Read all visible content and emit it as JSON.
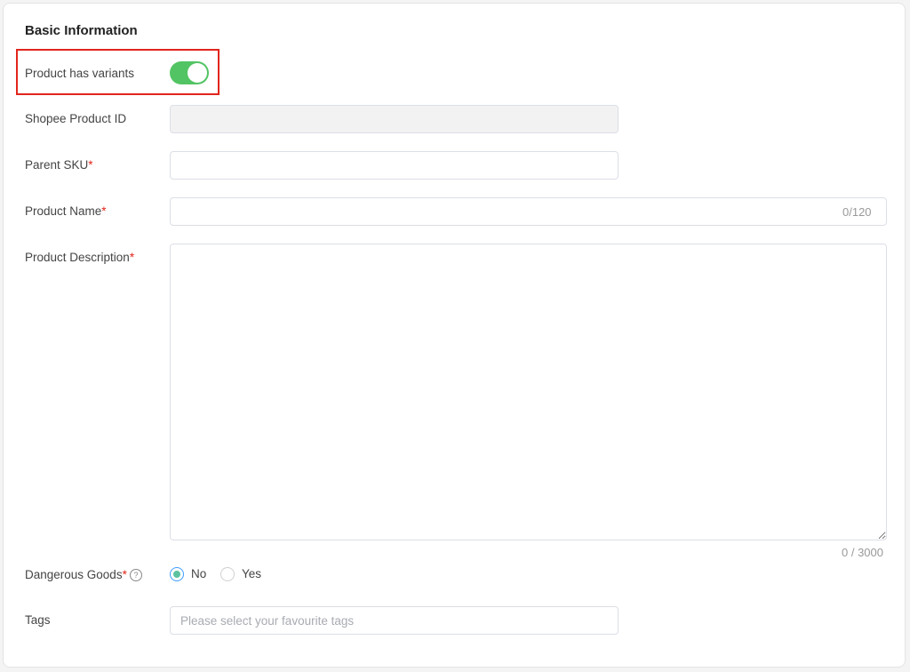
{
  "section_title": "Basic Information",
  "fields": {
    "has_variants": {
      "label": "Product has variants",
      "enabled": true
    },
    "shopee_product_id": {
      "label": "Shopee Product ID",
      "value": ""
    },
    "parent_sku": {
      "label": "Parent SKU",
      "required_mark": "*",
      "value": ""
    },
    "product_name": {
      "label": "Product Name",
      "required_mark": "*",
      "value": "",
      "counter": "0/120"
    },
    "product_description": {
      "label": "Product Description",
      "required_mark": "*",
      "value": "",
      "counter": "0 / 3000"
    },
    "dangerous_goods": {
      "label": "Dangerous Goods",
      "required_mark": "*",
      "help_glyph": "?",
      "options": [
        {
          "label": "No",
          "checked": true
        },
        {
          "label": "Yes",
          "checked": false
        }
      ]
    },
    "tags": {
      "label": "Tags",
      "placeholder": "Please select your favourite tags"
    }
  },
  "colors": {
    "toggle_on": "#52c463",
    "required": "#e1251b",
    "highlight": "#e1251b"
  }
}
